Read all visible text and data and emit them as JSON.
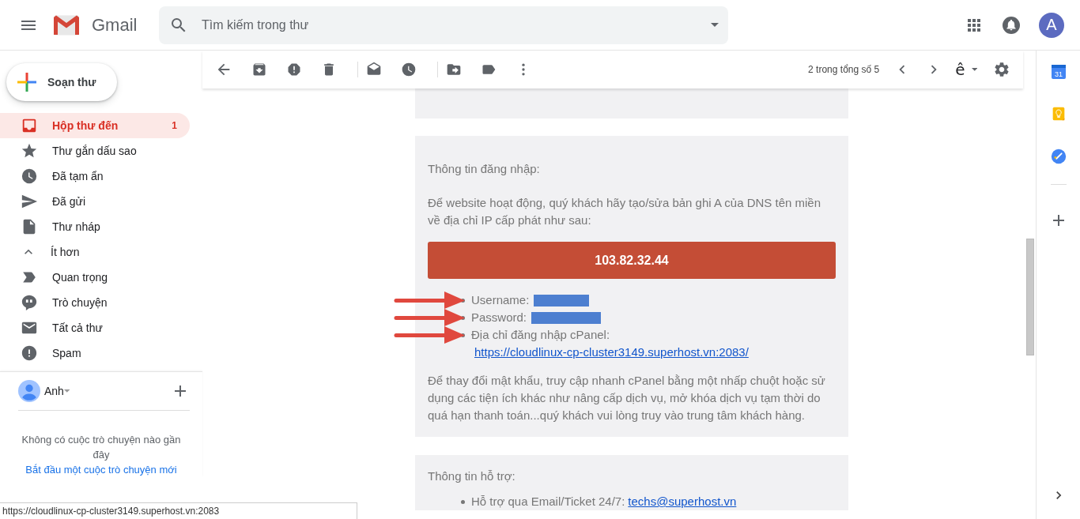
{
  "header": {
    "app_name": "Gmail",
    "search": {
      "placeholder": "Tìm kiếm trong thư"
    },
    "account_initial": "A"
  },
  "sidebar": {
    "compose": "Soạn thư",
    "items": [
      {
        "kind": "inbox",
        "label": "Hộp thư đến",
        "count": "1",
        "selected": true
      },
      {
        "kind": "star",
        "label": "Thư gắn dấu sao",
        "selected": false
      },
      {
        "kind": "clock",
        "label": "Đã tạm ẩn",
        "selected": false
      },
      {
        "kind": "send",
        "label": "Đã gửi",
        "selected": false
      },
      {
        "kind": "file",
        "label": "Thư nháp",
        "selected": false
      },
      {
        "kind": "less",
        "label": "Ít hơn",
        "selected": false
      },
      {
        "kind": "important",
        "label": "Quan trọng",
        "selected": false
      },
      {
        "kind": "chat",
        "label": "Trò chuyện",
        "selected": false
      },
      {
        "kind": "mail",
        "label": "Tất cả thư",
        "selected": false
      },
      {
        "kind": "spam",
        "label": "Spam",
        "selected": false
      }
    ]
  },
  "hangouts": {
    "user": "Anh",
    "empty_text": "Không có cuộc trò chuyện nào gần đây",
    "start_link": "Bắt đầu một cuộc trò chuyện mới"
  },
  "toolbar": {
    "pagination": "2 trong tổng số 5",
    "input_tool": "ê"
  },
  "email": {
    "sections": [
      {
        "heading": "Thông tin đăng nhập:",
        "intro": "Để website hoạt động, quý khách hãy tạo/sửa bản ghi A của DNS tên miền về địa chỉ IP cấp phát như sau:",
        "ip": "103.82.32.44",
        "details": [
          {
            "label": "Username:",
            "redacted": true,
            "annotated": true
          },
          {
            "label": "Password:",
            "redacted": true,
            "annotated": true
          },
          {
            "label": "Địa chỉ đăng nhập cPanel:",
            "link": "https://cloudlinux-cp-cluster3149.superhost.vn:2083/",
            "annotated": true
          }
        ],
        "note": "Để thay đổi mật khẩu, truy cập nhanh cPanel bằng một nhấp chuột hoặc sử dụng các tiện ích khác như nâng cấp dịch vụ, mở khóa dịch vụ tạm thời do quá hạn thanh toán...quý khách vui lòng truy vào trung tâm khách hàng."
      },
      {
        "heading": "Thông tin hỗ trợ:",
        "details": [
          {
            "label": "Hỗ trợ qua Email/Ticket 24/7:",
            "link": "techs@superhost.vn"
          }
        ]
      }
    ]
  },
  "right_panel": {
    "calendar_day": "31"
  },
  "status_bar": {
    "url": "https://cloudlinux-cp-cluster3149.superhost.vn:2083"
  }
}
